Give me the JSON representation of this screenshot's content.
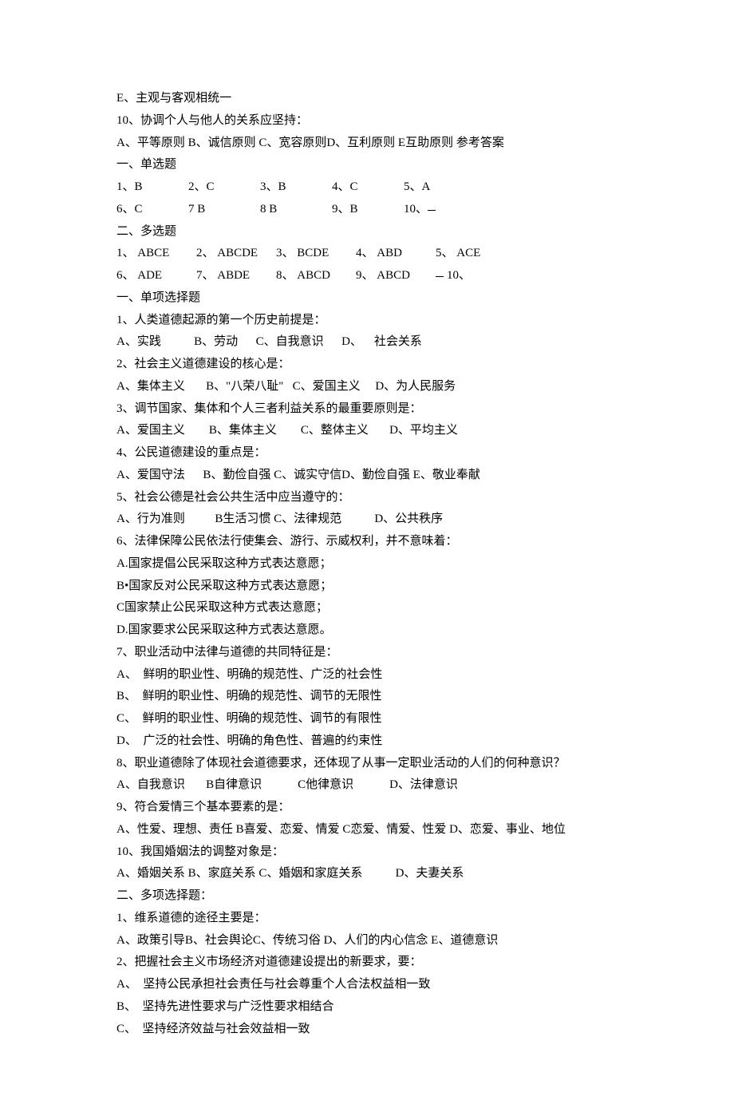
{
  "top": {
    "l1": "E、主观与客观相统一",
    "l2": "10、协调个人与他人的关系应坚持：",
    "l3": "A、平等原则 B、诚信原则 C、宽容原则D、互利原则 E互助原则 参考答案"
  },
  "ans1": {
    "hdr": "一、单选题",
    "r1": {
      "a": "1、B",
      "b": "2、C",
      "c": "3、B",
      "d": "4、C",
      "e": "5、A"
    },
    "r2": {
      "a": "6、C",
      "b": "7  B",
      "c": "8    B",
      "d": "9、B",
      "e": "10、"
    }
  },
  "ans2": {
    "hdr": "二、多选题",
    "r1": {
      "a": "1、 ABCE",
      "b": "2、 ABCDE",
      "c": "3、 BCDE",
      "d": "4、 ABD",
      "e": "5、 ACE"
    },
    "r2": {
      "a": "6、 ADE",
      "b": "7、 ABDE",
      "c": "8、 ABCD",
      "d": "9、 ABCD",
      "e": "10、"
    }
  },
  "sec1": {
    "hdr": "一、单项选择题",
    "q1": {
      "t": "1、人类道德起源的第一个历史前提是：",
      "o": "A、实践           B、劳动      C、自我意识      D、    社会关系"
    },
    "q2": {
      "t": "2、社会主义道德建设的核心是：",
      "o": "A、集体主义       B、\"八荣八耻\"   C、爱国主义     D、为人民服务"
    },
    "q3": {
      "t": "3、调节国家、集体和个人三者利益关系的最重要原则是：",
      "o": "A、爱国主义        B、集体主义        C、整体主义       D、平均主义"
    },
    "q4": {
      "t": "4、公民道德建设的重点是：",
      "o": "A、爱国守法      B、勤俭自强 C、诚实守信D、勤俭自强 E、敬业奉献"
    },
    "q5": {
      "t": "5、社会公德是社会公共生活中应当遵守的：",
      "o": "A、行为准则          B生活习惯 C、法律规范           D、公共秩序"
    },
    "q6": {
      "t": "6、法律保障公民依法行使集会、游行、示威权利，并不意味着：",
      "a": "A.国家提倡公民采取这种方式表达意愿；",
      "b": "B•国家反对公民采取这种方式表达意愿；",
      "c": "C国家禁止公民采取这种方式表达意愿；",
      "d": "D.国家要求公民采取这种方式表达意愿。"
    },
    "q7": {
      "t": "7、职业活动中法律与道德的共同特征是：",
      "a": "A、  鲜明的职业性、明确的规范性、广泛的社会性",
      "b": "B、  鲜明的职业性、明确的规范性、调节的无限性",
      "c": "C、  鲜明的职业性、明确的规范性、调节的有限性",
      "d": "D、  广泛的社会性、明确的角色性、普遍的约束性"
    },
    "q8": {
      "t": "8、职业道德除了体现社会道德要求，还体现了从事一定职业活动的人们的何种意识？",
      "o": "A、自我意识       B自律意识            C他律意识            D、法律意识"
    },
    "q9": {
      "t": "9、符合爱情三个基本要素的是：",
      "o": "A、性爱、理想、责任 B喜爱、恋爱、情爱 C恋爱、情爱、性爱 D、恋爱、事业、地位"
    },
    "q10": {
      "t": "10、我国婚姻法的调整对象是：",
      "o": "A、婚姻关系 B、家庭关系 C、婚姻和家庭关系           D、夫妻关系"
    }
  },
  "sec2": {
    "hdr": "二、多项选择题：",
    "q1": {
      "t": "1、维系道德的途径主要是：",
      "o": "A、政策引导B、社会舆论C、传统习俗 D、人们的内心信念 E、道德意识"
    },
    "q2": {
      "t": "2、把握社会主义市场经济对道德建设提出的新要求，要：",
      "a": "A、  坚持公民承担社会责任与社会尊重个人合法权益相一致",
      "b": "B、  坚持先进性要求与广泛性要求相结合",
      "c": "C、  坚持经济效益与社会效益相一致"
    }
  }
}
